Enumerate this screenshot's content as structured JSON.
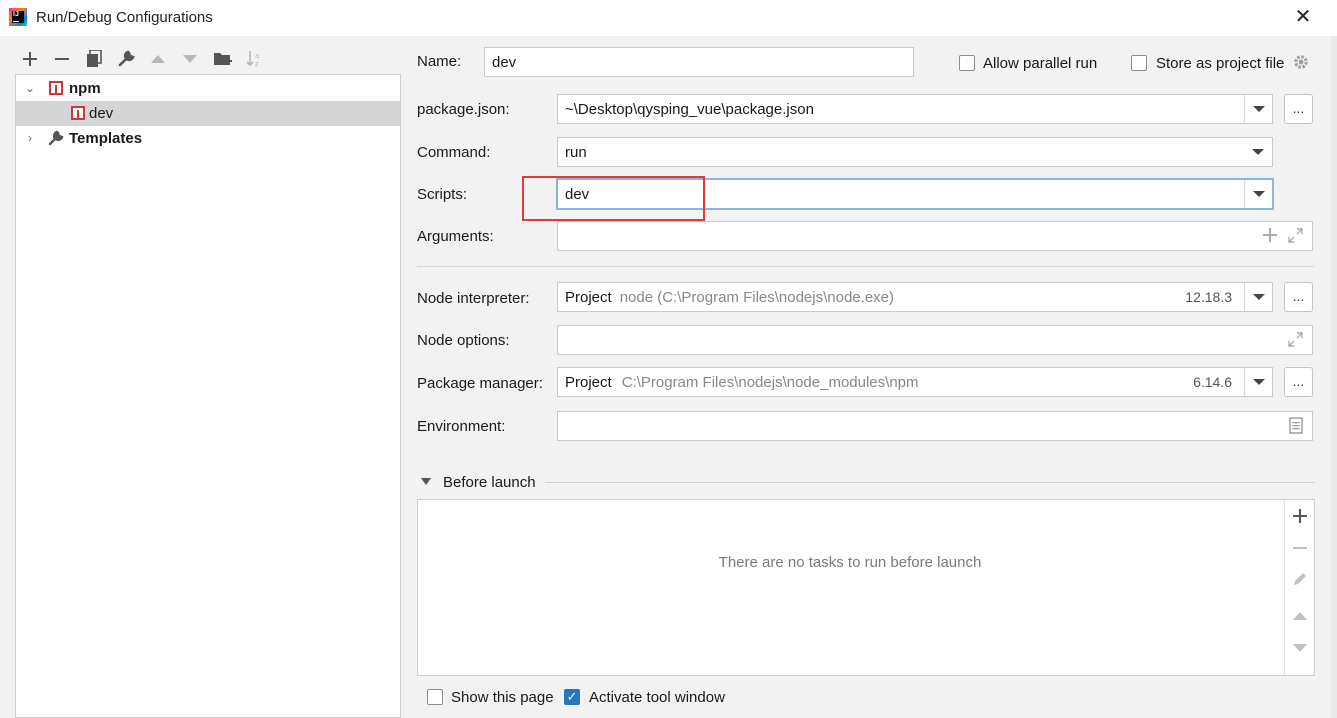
{
  "window": {
    "title": "Run/Debug Configurations",
    "close_glyph": "✕"
  },
  "tree": {
    "npm_label": "npm",
    "dev_label": "dev",
    "templates_label": "Templates"
  },
  "form": {
    "name_label": "Name:",
    "name_value": "dev",
    "allow_parallel_label": "Allow parallel run",
    "store_project_label": "Store as project file",
    "package_json_label": "package.json:",
    "package_json_value": "~\\Desktop\\qysping_vue\\package.json",
    "command_label": "Command:",
    "command_value": "run",
    "scripts_label": "Scripts:",
    "scripts_value": "dev",
    "arguments_label": "Arguments:",
    "arguments_value": "",
    "node_interpreter_label": "Node interpreter:",
    "node_interpreter_prefix": "Project",
    "node_interpreter_path": "node (C:\\Program Files\\nodejs\\node.exe)",
    "node_interpreter_version": "12.18.3",
    "node_options_label": "Node options:",
    "node_options_value": "",
    "package_manager_label": "Package manager:",
    "package_manager_prefix": "Project",
    "package_manager_path": "C:\\Program Files\\nodejs\\node_modules\\npm",
    "package_manager_version": "6.14.6",
    "environment_label": "Environment:",
    "environment_value": "",
    "browse_label": "...",
    "before_launch_label": "Before launch",
    "empty_tasks_text": "There are no tasks to run before launch",
    "show_page_label": "Show this page",
    "activate_tool_label": "Activate tool window"
  },
  "checkboxes": {
    "allow_parallel": false,
    "store_project": false,
    "show_page": false,
    "activate_tool": true
  }
}
